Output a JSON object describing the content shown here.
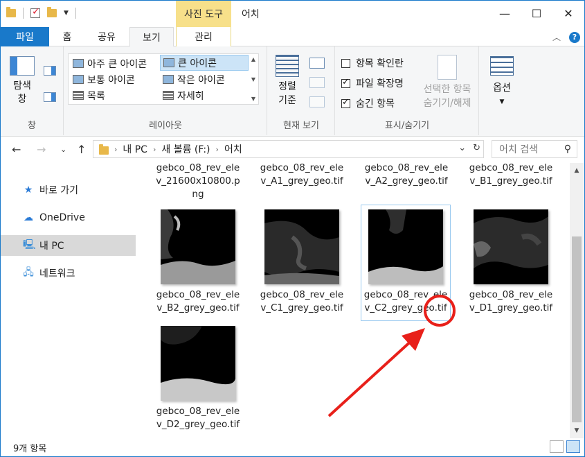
{
  "title_bar": {
    "context_tab": "사진 도구",
    "window_title": "어치",
    "controls": {
      "minimize": "—",
      "maximize": "☐",
      "close": "✕"
    }
  },
  "tabs": {
    "file": "파일",
    "home": "홈",
    "share": "공유",
    "view": "보기",
    "manage": "관리"
  },
  "ribbon": {
    "pane": {
      "label_line1": "탐색",
      "label_line2": "창",
      "group": "창"
    },
    "layout": {
      "group": "레이아웃",
      "items": [
        {
          "label": "아주 큰 아이콘",
          "selected": false
        },
        {
          "label": "큰 아이콘",
          "selected": true
        },
        {
          "label": "보통 아이콘",
          "selected": false
        },
        {
          "label": "작은 아이콘",
          "selected": false
        },
        {
          "label": "목록",
          "selected": false
        },
        {
          "label": "자세히",
          "selected": false
        }
      ]
    },
    "current_view": {
      "sort_line1": "정렬",
      "sort_line2": "기준",
      "group": "현재 보기"
    },
    "show_hide": {
      "group": "표시/숨기기",
      "checkboxes": [
        {
          "label": "항목 확인란",
          "checked": false
        },
        {
          "label": "파일 확장명",
          "checked": true
        },
        {
          "label": "숨긴 항목",
          "checked": true
        }
      ],
      "hide_selected_line1": "선택한 항목",
      "hide_selected_line2": "숨기기/해제"
    },
    "options": {
      "label": "옵션"
    }
  },
  "address": {
    "crumbs": [
      "내 PC",
      "새 볼륨 (F:)",
      "어치"
    ],
    "search_placeholder": "어치 검색"
  },
  "nav_pane": {
    "items": [
      {
        "label": "바로 가기",
        "icon": "star-icon"
      },
      {
        "label": "OneDrive",
        "icon": "cloud-icon"
      },
      {
        "label": "내 PC",
        "icon": "computer-icon",
        "selected": true
      },
      {
        "label": "네트워크",
        "icon": "network-icon"
      }
    ]
  },
  "files": [
    {
      "name": "gebco_08_rev_elev_21600x10800.png"
    },
    {
      "name": "gebco_08_rev_elev_A1_grey_geo.tif"
    },
    {
      "name": "gebco_08_rev_elev_A2_grey_geo.tif"
    },
    {
      "name": "gebco_08_rev_elev_B1_grey_geo.tif"
    },
    {
      "name": "gebco_08_rev_elev_B2_grey_geo.tif"
    },
    {
      "name": "gebco_08_rev_elev_C1_grey_geo.tif"
    },
    {
      "name": "gebco_08_rev_elev_C2_grey_geo.tif"
    },
    {
      "name": "gebco_08_rev_elev_D1_grey_geo.tif"
    },
    {
      "name": "gebco_08_rev_elev_D2_grey_geo.tif"
    }
  ],
  "file_lines": {
    "f0": [
      "gebco_08_rev_ele",
      "v_21600x10800.p",
      "ng"
    ],
    "f1": [
      "gebco_08_rev_ele",
      "v_A1_grey_geo.tif"
    ],
    "f2": [
      "gebco_08_rev_ele",
      "v_A2_grey_geo.tif"
    ],
    "f3": [
      "gebco_08_rev_ele",
      "v_B1_grey_geo.tif"
    ],
    "f4": [
      "gebco_08_rev_ele",
      "v_B2_grey_geo.tif"
    ],
    "f5": [
      "gebco_08_rev_ele",
      "v_C1_grey_geo.tif"
    ],
    "f6": [
      "gebco_08_rev_ele",
      "v_C2_grey_geo.tif"
    ],
    "f7": [
      "gebco_08_rev_ele",
      "v_D1_grey_geo.tif"
    ],
    "f8": [
      "gebco_08_rev_ele",
      "v_D2_grey_geo.tif"
    ]
  },
  "status": {
    "item_count": "9개 항목"
  },
  "annotation": {
    "color": "#e8201a"
  },
  "colors": {
    "accent": "#1979ca",
    "context_tab": "#f7e08a",
    "selection": "#cce4f7"
  }
}
